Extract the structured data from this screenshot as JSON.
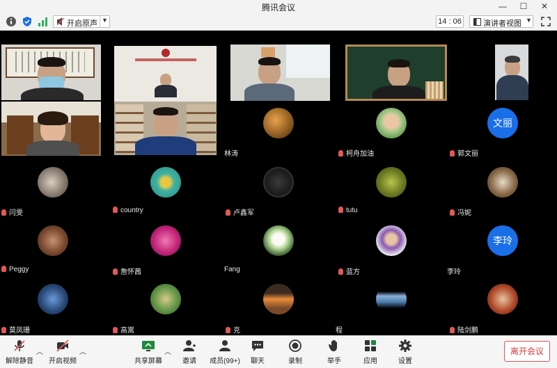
{
  "window": {
    "title": "腾讯会议"
  },
  "topbar": {
    "audio_button": "开启原声",
    "meeting_time": "14 : 06",
    "view_button": "演讲者视图"
  },
  "participants": [
    {
      "name": "林涛",
      "avatar": "food-photo"
    },
    {
      "name": "柯舟加油",
      "avatar": "girl-photo"
    },
    {
      "name": "郭文丽",
      "avatar": "text-avatar",
      "avatar_text": "文丽"
    },
    {
      "name": "闫雯",
      "avatar": "pets-photo"
    },
    {
      "name": "country",
      "avatar": "flower-photo"
    },
    {
      "name": "卢鑫军",
      "avatar": "dark-photo"
    },
    {
      "name": "tutu",
      "avatar": "plant-photo"
    },
    {
      "name": "冯妮",
      "avatar": "scene-photo"
    },
    {
      "name": "Peggy",
      "avatar": "portrait-photo"
    },
    {
      "name": "詹怀茜",
      "avatar": "pink-flower-photo"
    },
    {
      "name": "Fang",
      "avatar": "lotus-photo"
    },
    {
      "name": "蓝方",
      "avatar": "woman-photo"
    },
    {
      "name": "李玲",
      "avatar": "text-avatar",
      "avatar_text": "李玲"
    },
    {
      "name": "莫凤珊",
      "avatar": "sky-photo"
    },
    {
      "name": "高嵩",
      "avatar": "grass-photo"
    },
    {
      "name": "克",
      "avatar": "sunset-photo"
    },
    {
      "name": "程",
      "avatar": "lake-photo"
    },
    {
      "name": "陆剑鹏",
      "avatar": "food-photo"
    }
  ],
  "bottombar": {
    "unmute": "解除静音",
    "video": "开启视频",
    "share": "共享屏幕",
    "invite": "邀请",
    "members": "成员(99+)",
    "chat": "聊天",
    "record": "录制",
    "raise_hand": "举手",
    "apps": "应用",
    "settings": "设置",
    "leave": "离开会议"
  },
  "colors": {
    "leave": "#d93a3a",
    "mic_muted": "#e35757",
    "text_avatar": "#1a6fe8"
  }
}
